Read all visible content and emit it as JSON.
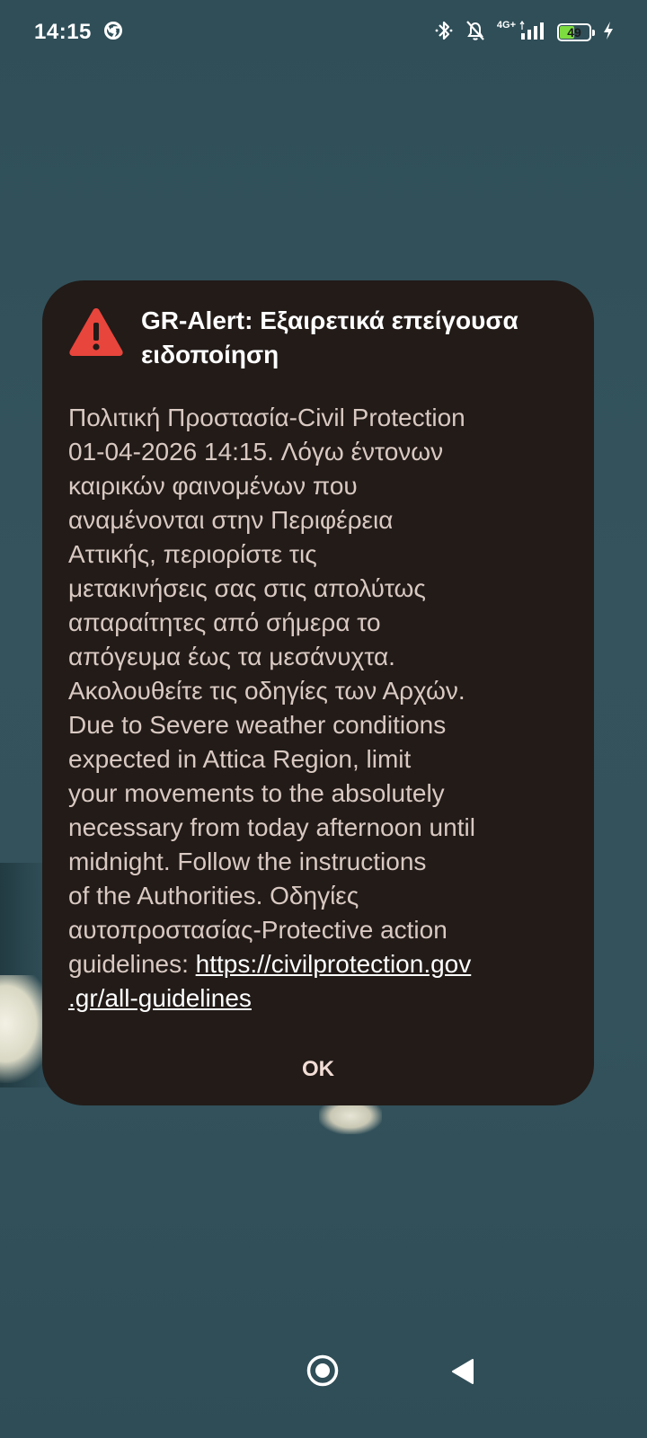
{
  "status_bar": {
    "time": "14:15",
    "network_label": "4G+",
    "battery_level": "49",
    "battery_percent": 49,
    "icons": [
      "chrome-icon",
      "bluetooth-icon",
      "silent-bell-icon",
      "signal-icon",
      "battery-icon",
      "charging-icon"
    ]
  },
  "dialog": {
    "title": "GR-Alert: Εξαιρετικά επείγουσα ειδοποίηση",
    "icon": "warning-icon",
    "icon_color": "#e8453c",
    "body_lines": [
      "Πολιτική Προστασία-Civil Protection",
      "01-04-2026 14:15. Λόγω έντονων",
      "καιρικών φαινομένων που",
      "αναμένονται στην Περιφέρεια",
      "Αττικής, περιορίστε τις",
      "μετακινήσεις σας στις απολύτως",
      "απαραίτητες από σήμερα το",
      "απόγευμα έως τα μεσάνυχτα.",
      "Ακολουθείτε τις οδηγίες των Αρχών.",
      "Due to Severe weather conditions",
      "expected in Attica Region, limit",
      "your movements to the absolutely",
      "necessary from today afternoon until",
      "midnight. Follow the instructions",
      "of the Authorities. Οδηγίες",
      "αυτοπροστασίας-Protective action"
    ],
    "body_tail_text": "guidelines: ",
    "link_line1": "https://civilprotection.gov",
    "link_line2": ".gr/all-guidelines",
    "ok_label": "OK"
  },
  "nav_bar": {
    "icons": [
      "home-circle-icon",
      "back-triangle-icon"
    ]
  },
  "colors": {
    "dialog_background": "#221b18",
    "body_text": "#d9c9c2",
    "battery_fill": "#7ddc3f",
    "wallpaper": "#34535d"
  }
}
